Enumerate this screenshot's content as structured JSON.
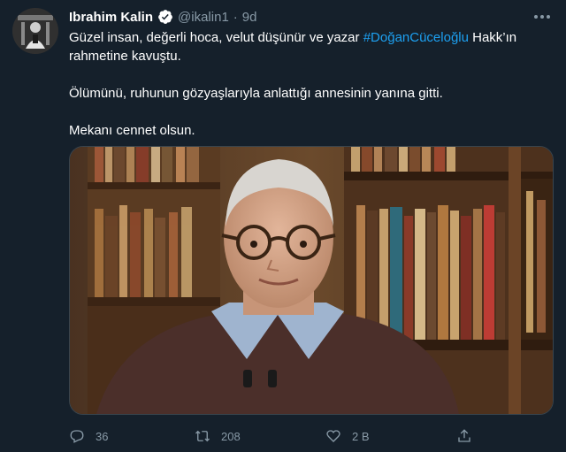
{
  "tweet": {
    "author_name": "Ibrahim Kalin",
    "handle": "@ikalin1",
    "separator": "·",
    "time": "9d",
    "more_icon": "more-icon",
    "verified_icon": "verified-badge-icon",
    "line1_before": "Güzel insan, değerli hoca, velut düşünür ve yazar ",
    "hashtag": "#DoğanCüceloğlu",
    "line1_after": " Hakk’ın rahmetine kavuştu.",
    "paragraph2": "Ölümünü, ruhunun gözyaşlarıyla anlattığı annesinin yanına gitti.",
    "paragraph3": "Mekanı cennet olsun."
  },
  "actions": {
    "reply_count": "36",
    "retweet_count": "208",
    "like_count": "2 B",
    "reply_icon": "reply-icon",
    "retweet_icon": "retweet-icon",
    "like_icon": "heart-icon",
    "share_icon": "share-icon"
  },
  "colors": {
    "background": "#15202b",
    "text": "#ffffff",
    "muted": "#8899a6",
    "accent": "#1da1f2"
  }
}
